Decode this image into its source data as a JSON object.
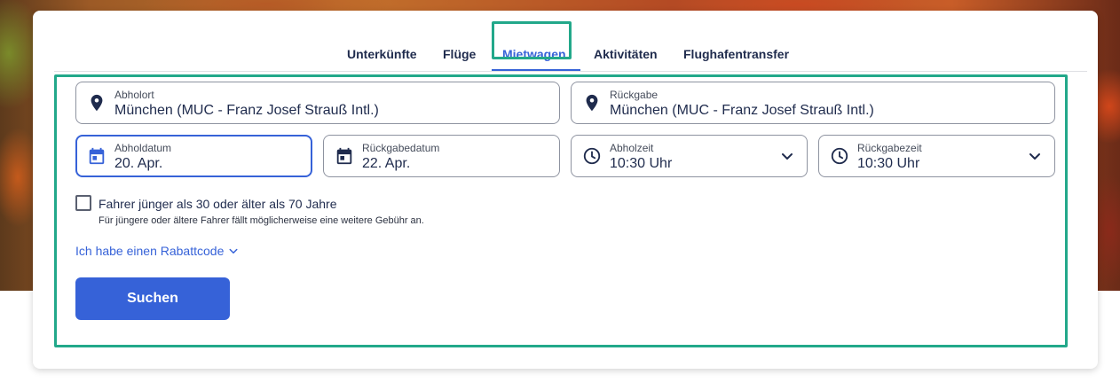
{
  "tabs": [
    {
      "label": "Unterkünfte",
      "active": false
    },
    {
      "label": "Flüge",
      "active": false
    },
    {
      "label": "Mietwagen",
      "active": true
    },
    {
      "label": "Aktivitäten",
      "active": false
    },
    {
      "label": "Flughafentransfer",
      "active": false
    }
  ],
  "pickup_location": {
    "label": "Abholort",
    "value": "München (MUC - Franz Josef Strauß Intl.)",
    "icon": "map-pin-icon"
  },
  "return_location": {
    "label": "Rückgabe",
    "value": "München (MUC - Franz Josef Strauß Intl.)",
    "icon": "map-pin-icon"
  },
  "pickup_date": {
    "label": "Abholdatum",
    "value": "20. Apr.",
    "icon": "calendar-icon"
  },
  "return_date": {
    "label": "Rückgabedatum",
    "value": "22. Apr.",
    "icon": "calendar-icon"
  },
  "pickup_time": {
    "label": "Abholzeit",
    "value": "10:30 Uhr",
    "icon": "clock-icon"
  },
  "return_time": {
    "label": "Rückgabezeit",
    "value": "10:30 Uhr",
    "icon": "clock-icon"
  },
  "driver_age": {
    "label": "Fahrer jünger als 30 oder älter als 70 Jahre",
    "help": "Für jüngere oder ältere Fahrer fällt möglicherweise eine weitere Gebühr an.",
    "checked": false
  },
  "promo_link": "Ich habe einen Rabattcode",
  "search_button": "Suchen",
  "colors": {
    "accent": "#3662d8",
    "highlight": "#22a88a",
    "text": "#1f2b4d"
  }
}
